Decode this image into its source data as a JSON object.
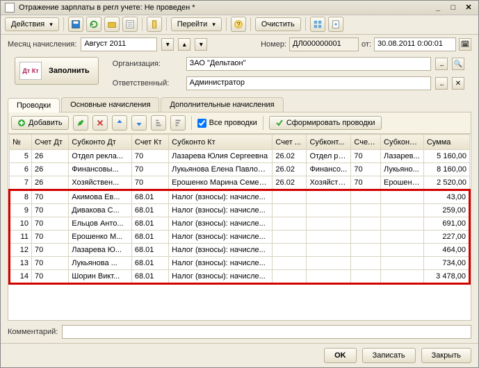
{
  "title": "Отражение зарплаты в регл учете: Не проведен *",
  "toolbar": {
    "actions": "Действия",
    "goto": "Перейти",
    "clear": "Очистить"
  },
  "form": {
    "month_label": "Месяц начисления:",
    "month_value": "Август 2011",
    "number_label": "Номер:",
    "number_value": "ДЛ000000001",
    "from_label": "от:",
    "date_value": "30.08.2011 0:00:01",
    "org_label": "Организация:",
    "org_value": "ЗАО \"Дельтаон\"",
    "resp_label": "Ответственный:",
    "resp_value": "Администратор",
    "fill_btn": "Заполнить",
    "fill_icon": "Дт Кт"
  },
  "tabs": [
    "Проводки",
    "Основные начисления",
    "Дополнительные начисления"
  ],
  "subtoolbar": {
    "add": "Добавить",
    "allpostings": "Все проводки",
    "form_postings": "Сформировать проводки"
  },
  "columns": [
    "№",
    "Счет Дт",
    "Субконто Дт",
    "Счет Кт",
    "Субконто Кт",
    "Счет ...",
    "Субконт...",
    "Счет ...",
    "Субконто...",
    "Сумма"
  ],
  "colwidths": [
    "30px",
    "50px",
    "85px",
    "50px",
    "140px",
    "46px",
    "60px",
    "40px",
    "58px",
    "62px"
  ],
  "rows": [
    {
      "n": "5",
      "dt": "26",
      "sd": "Отдел рекла...",
      "kt": "70",
      "sk": "Лазарева Юлия Сергеевна",
      "c1": "26.02",
      "s1": "Отдел ре...",
      "c2": "70",
      "s2": "Лазарев...",
      "sum": "5 160,00",
      "hl": false
    },
    {
      "n": "6",
      "dt": "26",
      "sd": "Финансовы...",
      "kt": "70",
      "sk": "Лукьянова Елена Павловна",
      "c1": "26.02",
      "s1": "Финансо...",
      "c2": "70",
      "s2": "Лукьяно...",
      "sum": "8 160,00",
      "hl": false
    },
    {
      "n": "7",
      "dt": "26",
      "sd": "Хозяйствен...",
      "kt": "70",
      "sk": "Ерошенко Марина Семеновна",
      "c1": "26.02",
      "s1": "Хозяйств...",
      "c2": "70",
      "s2": "Ерошенк...",
      "sum": "2 520,00",
      "hl": false
    },
    {
      "n": "8",
      "dt": "70",
      "sd": "Акимова Ев...",
      "kt": "68.01",
      "sk": "Налог (взносы): начисле...",
      "c1": "",
      "s1": "",
      "c2": "",
      "s2": "",
      "sum": "43,00",
      "hl": true,
      "first": true
    },
    {
      "n": "9",
      "dt": "70",
      "sd": "Дивакова С...",
      "kt": "68.01",
      "sk": "Налог (взносы): начисле...",
      "c1": "",
      "s1": "",
      "c2": "",
      "s2": "",
      "sum": "259,00",
      "hl": true
    },
    {
      "n": "10",
      "dt": "70",
      "sd": "Ельцов Анто...",
      "kt": "68.01",
      "sk": "Налог (взносы): начисле...",
      "c1": "",
      "s1": "",
      "c2": "",
      "s2": "",
      "sum": "691,00",
      "hl": true
    },
    {
      "n": "11",
      "dt": "70",
      "sd": "Ерошенко М...",
      "kt": "68.01",
      "sk": "Налог (взносы): начисле...",
      "c1": "",
      "s1": "",
      "c2": "",
      "s2": "",
      "sum": "227,00",
      "hl": true
    },
    {
      "n": "12",
      "dt": "70",
      "sd": "Лазарева Ю...",
      "kt": "68.01",
      "sk": "Налог (взносы): начисле...",
      "c1": "",
      "s1": "",
      "c2": "",
      "s2": "",
      "sum": "464,00",
      "hl": true
    },
    {
      "n": "13",
      "dt": "70",
      "sd": "Лукьянова ...",
      "kt": "68.01",
      "sk": "Налог (взносы): начисле...",
      "c1": "",
      "s1": "",
      "c2": "",
      "s2": "",
      "sum": "734,00",
      "hl": true
    },
    {
      "n": "14",
      "dt": "70",
      "sd": "Шорин Викт...",
      "kt": "68.01",
      "sk": "Налог (взносы): начисле...",
      "c1": "",
      "s1": "",
      "c2": "",
      "s2": "",
      "sum": "3 478,00",
      "hl": true,
      "last": true
    }
  ],
  "comment_label": "Комментарий:",
  "comment_value": "",
  "footer": {
    "ok": "OK",
    "save": "Записать",
    "close": "Закрыть"
  }
}
